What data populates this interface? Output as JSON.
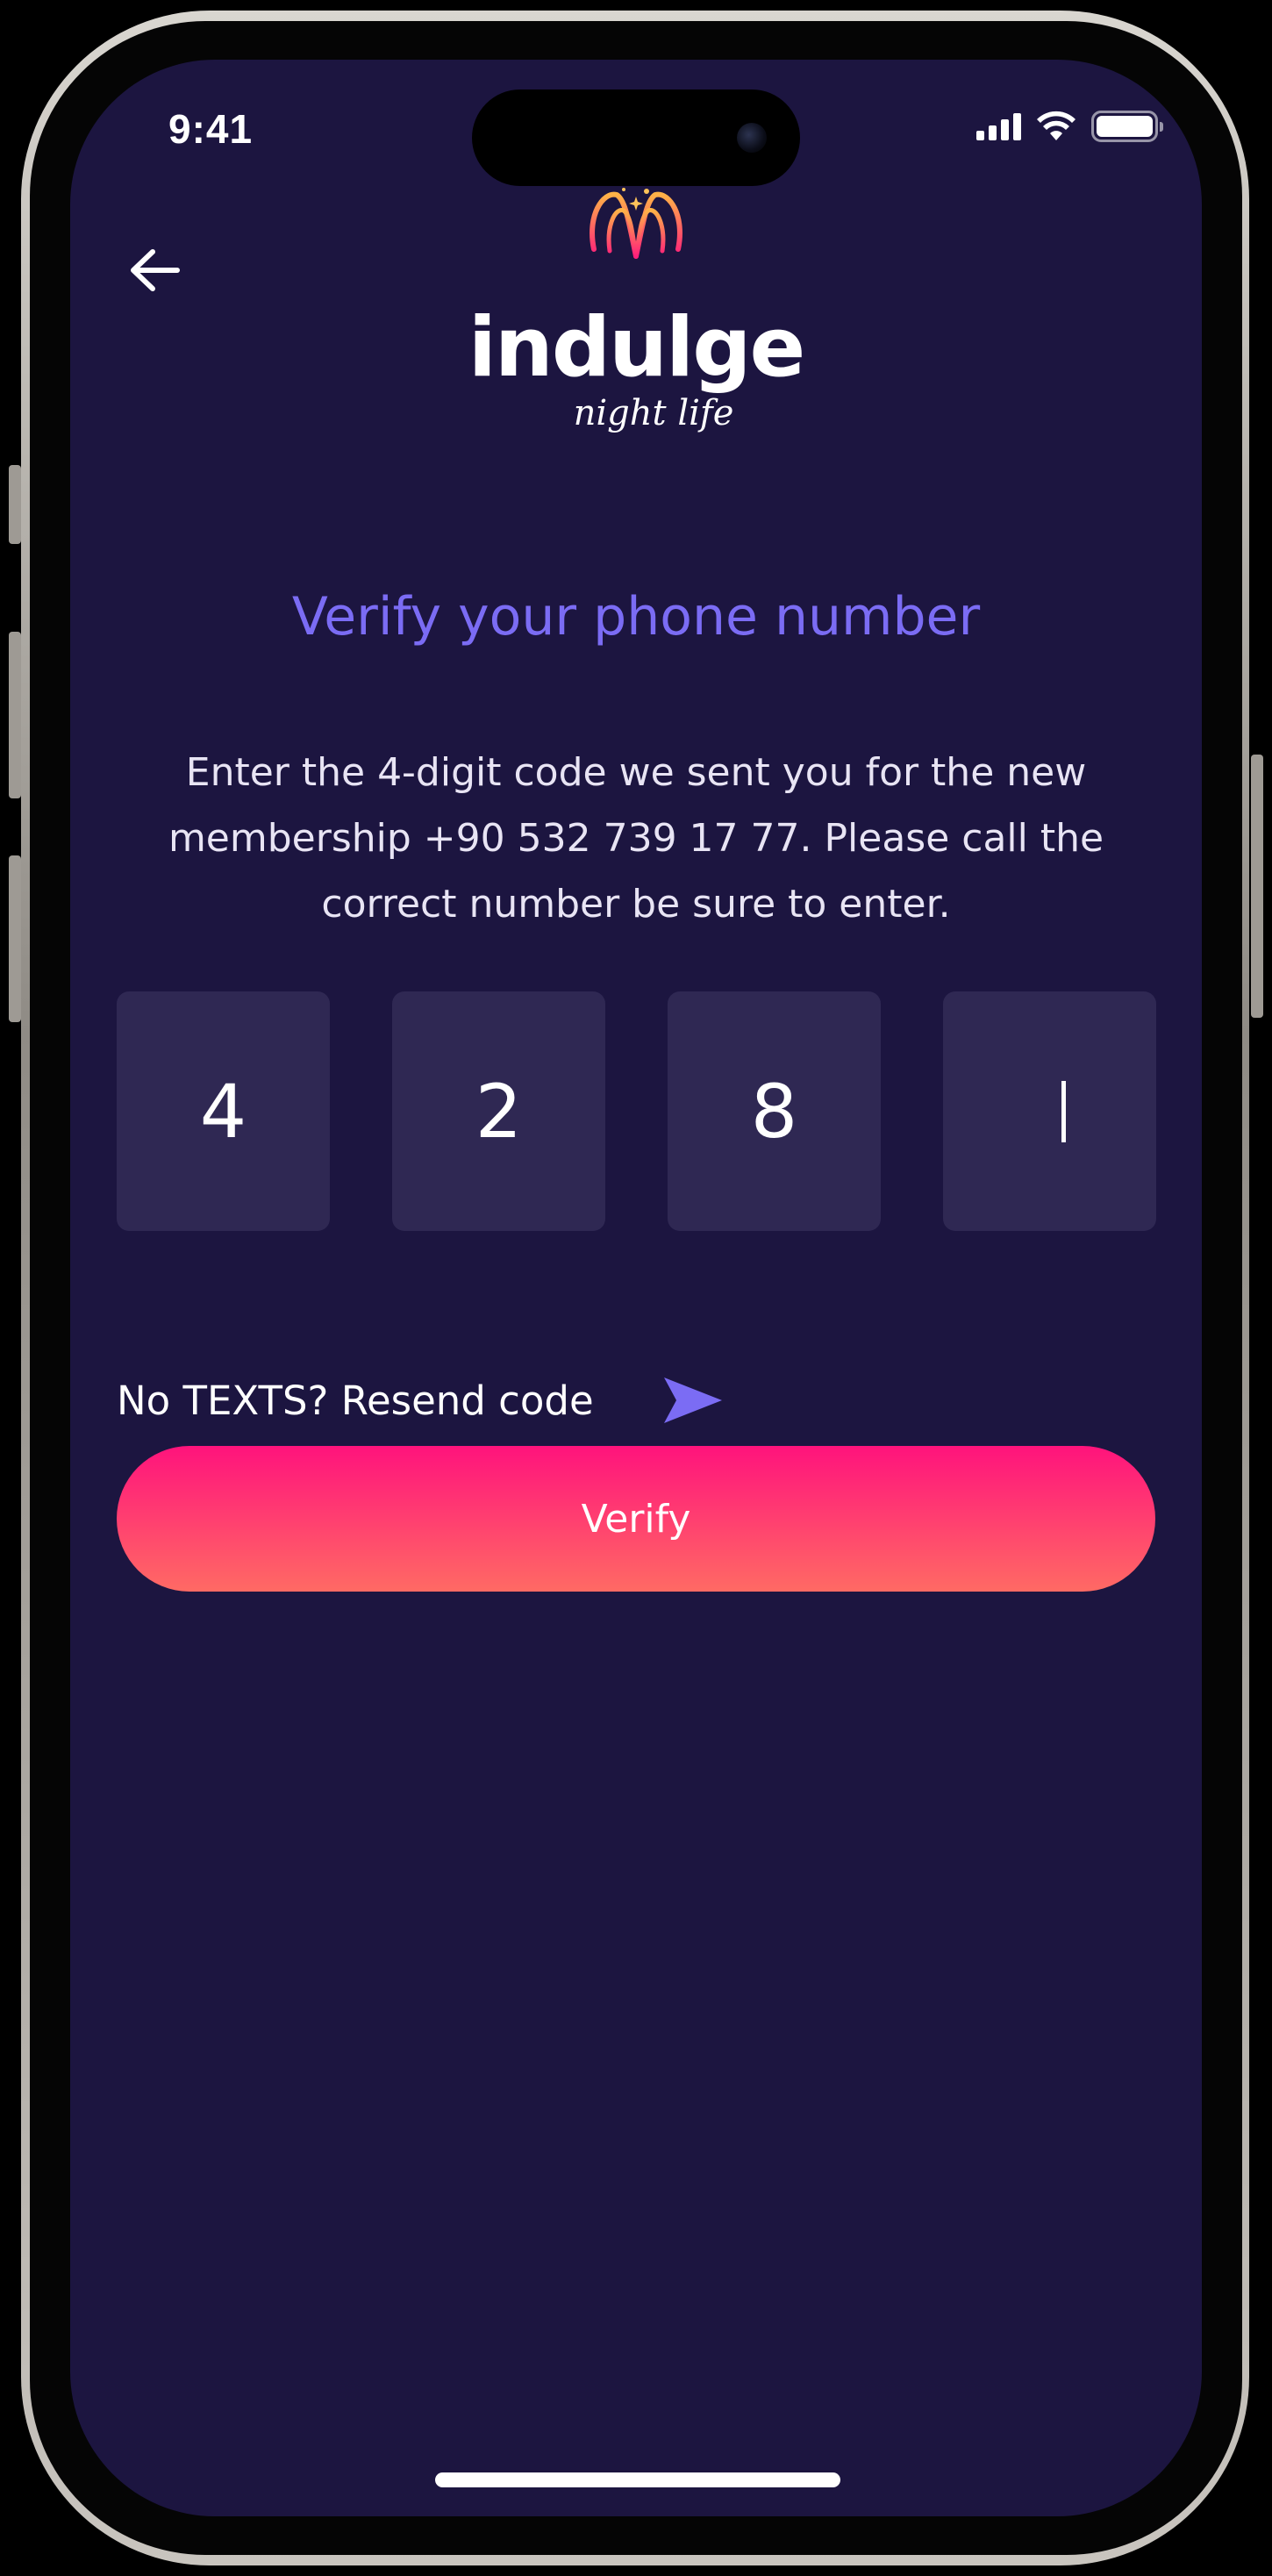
{
  "status_bar": {
    "time": "9:41"
  },
  "header": {
    "logo": {
      "wordmark": "indulge",
      "tagline": "night life"
    },
    "back_icon": "arrow-left-icon"
  },
  "verification": {
    "title": "Verify your phone number",
    "description": "Enter the 4-digit code we sent you for the new membership +90 532 739 17 77. Please call the correct number be sure to enter.",
    "code_digits": [
      "4",
      "2",
      "8",
      ""
    ],
    "resend_text": "No TEXTS? Resend code",
    "resend_icon": "send-icon",
    "verify_label": "Verify"
  },
  "colors": {
    "background": "#1c1540",
    "accent": "#7b6cf4",
    "code_box": "#2f2853",
    "button_gradient_start": "#ff137c",
    "button_gradient_end": "#ff6a64"
  }
}
